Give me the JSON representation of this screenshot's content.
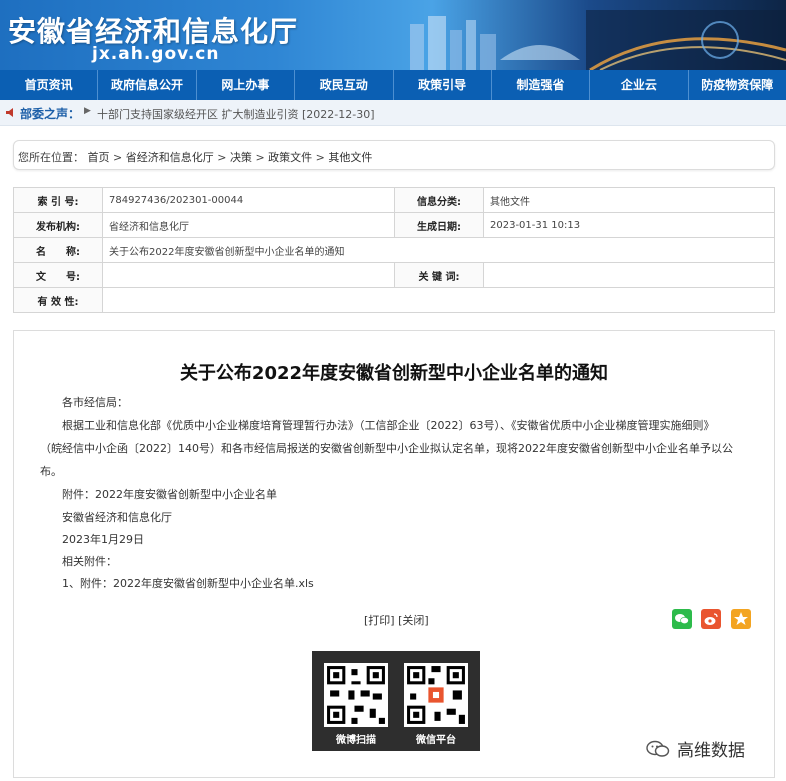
{
  "header": {
    "site_title": "安徽省经济和信息化厅",
    "site_url": "jx.ah.gov.cn"
  },
  "nav": {
    "items": [
      "首页资讯",
      "政府信息公开",
      "网上办事",
      "政民互动",
      "政策引导",
      "制造强省",
      "企业云",
      "防疫物资保障"
    ]
  },
  "notice": {
    "label": "部委之声：",
    "text": "十部门支持国家级经开区 扩大制造业引资 [2022-12-30]"
  },
  "breadcrumb": {
    "prefix": "您所在位置：",
    "items": [
      "首页",
      "省经济和信息化厅",
      "决策",
      "政策文件",
      "其他文件"
    ],
    "sep": " > "
  },
  "info": {
    "index_key": "索 引 号:",
    "index_val": "784927436/202301-00044",
    "category_key": "信息分类:",
    "category_val": "其他文件",
    "publisher_key": "发布机构:",
    "publisher_val": "省经济和信息化厅",
    "date_key": "生成日期:",
    "date_val": "2023-01-31 10:13",
    "name_key": "名　　称:",
    "name_val": "关于公布2022年度安徽省创新型中小企业名单的通知",
    "docno_key": "文　　号:",
    "docno_val": "",
    "keywords_key": "关 键 词:",
    "keywords_val": "",
    "validity_key": "有 效 性:",
    "validity_val": ""
  },
  "article": {
    "title": "关于公布2022年度安徽省创新型中小企业名单的通知",
    "greeting": "各市经信局：",
    "body_line1": "根据工业和信息化部《优质中小企业梯度培育管理暂行办法》（工信部企业〔2022〕63号）、《安徽省优质中小企业梯度管理实施细则》",
    "body_line2": "（皖经信中小企函〔2022〕140号）和各市经信局报送的安徽省创新型中小企业拟认定名单，现将2022年度安徽省创新型中小企业名单予以公",
    "body_line3": "布。",
    "attachment": "附件：2022年度安徽省创新型中小企业名单",
    "signer": "安徽省经济和信息化厅",
    "date": "2023年1月29日",
    "related_label": "相关附件：",
    "related_file": "1、附件：2022年度安徽省创新型中小企业名单.xls",
    "print_label": "[打印]",
    "close_label": "[关闭]",
    "qr_weibo_label": "微博扫描",
    "qr_wechat_label": "微信平台"
  },
  "watermark": {
    "text": "高维数据"
  },
  "colors": {
    "nav_bg": "#0b5fb3",
    "notice_label": "#1c5fa8",
    "wechat": "#2dbb4b",
    "weibo": "#e9552f",
    "qzone": "#f3a421"
  }
}
